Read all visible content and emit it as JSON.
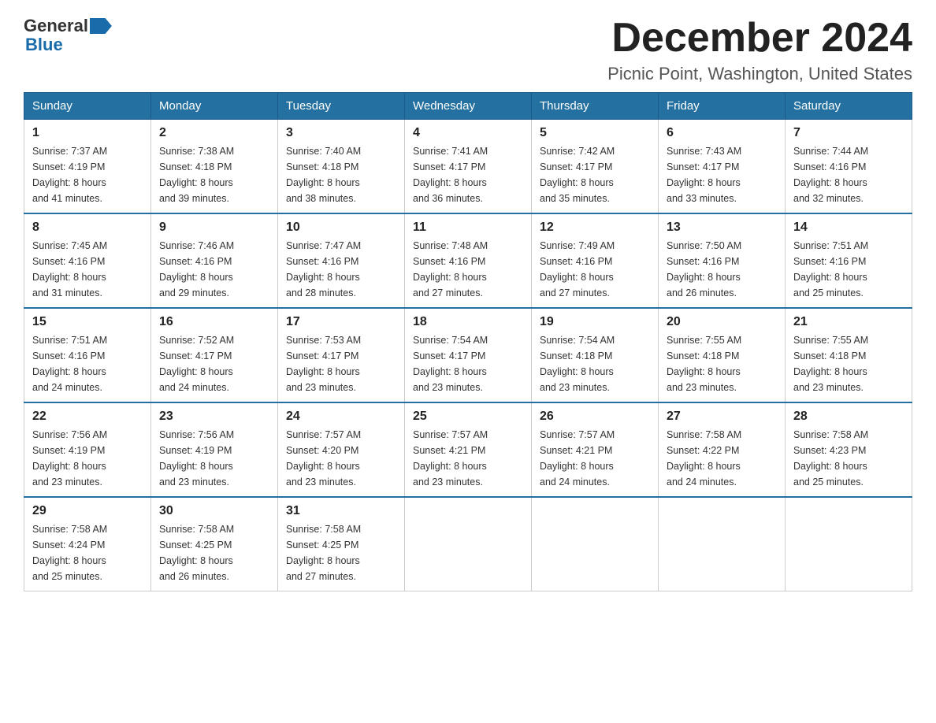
{
  "logo": {
    "general": "General",
    "blue": "Blue"
  },
  "header": {
    "title": "December 2024",
    "location": "Picnic Point, Washington, United States"
  },
  "days_of_week": [
    "Sunday",
    "Monday",
    "Tuesday",
    "Wednesday",
    "Thursday",
    "Friday",
    "Saturday"
  ],
  "weeks": [
    [
      {
        "day": "1",
        "sunrise": "7:37 AM",
        "sunset": "4:19 PM",
        "daylight": "8 hours and 41 minutes."
      },
      {
        "day": "2",
        "sunrise": "7:38 AM",
        "sunset": "4:18 PM",
        "daylight": "8 hours and 39 minutes."
      },
      {
        "day": "3",
        "sunrise": "7:40 AM",
        "sunset": "4:18 PM",
        "daylight": "8 hours and 38 minutes."
      },
      {
        "day": "4",
        "sunrise": "7:41 AM",
        "sunset": "4:17 PM",
        "daylight": "8 hours and 36 minutes."
      },
      {
        "day": "5",
        "sunrise": "7:42 AM",
        "sunset": "4:17 PM",
        "daylight": "8 hours and 35 minutes."
      },
      {
        "day": "6",
        "sunrise": "7:43 AM",
        "sunset": "4:17 PM",
        "daylight": "8 hours and 33 minutes."
      },
      {
        "day": "7",
        "sunrise": "7:44 AM",
        "sunset": "4:16 PM",
        "daylight": "8 hours and 32 minutes."
      }
    ],
    [
      {
        "day": "8",
        "sunrise": "7:45 AM",
        "sunset": "4:16 PM",
        "daylight": "8 hours and 31 minutes."
      },
      {
        "day": "9",
        "sunrise": "7:46 AM",
        "sunset": "4:16 PM",
        "daylight": "8 hours and 29 minutes."
      },
      {
        "day": "10",
        "sunrise": "7:47 AM",
        "sunset": "4:16 PM",
        "daylight": "8 hours and 28 minutes."
      },
      {
        "day": "11",
        "sunrise": "7:48 AM",
        "sunset": "4:16 PM",
        "daylight": "8 hours and 27 minutes."
      },
      {
        "day": "12",
        "sunrise": "7:49 AM",
        "sunset": "4:16 PM",
        "daylight": "8 hours and 27 minutes."
      },
      {
        "day": "13",
        "sunrise": "7:50 AM",
        "sunset": "4:16 PM",
        "daylight": "8 hours and 26 minutes."
      },
      {
        "day": "14",
        "sunrise": "7:51 AM",
        "sunset": "4:16 PM",
        "daylight": "8 hours and 25 minutes."
      }
    ],
    [
      {
        "day": "15",
        "sunrise": "7:51 AM",
        "sunset": "4:16 PM",
        "daylight": "8 hours and 24 minutes."
      },
      {
        "day": "16",
        "sunrise": "7:52 AM",
        "sunset": "4:17 PM",
        "daylight": "8 hours and 24 minutes."
      },
      {
        "day": "17",
        "sunrise": "7:53 AM",
        "sunset": "4:17 PM",
        "daylight": "8 hours and 23 minutes."
      },
      {
        "day": "18",
        "sunrise": "7:54 AM",
        "sunset": "4:17 PM",
        "daylight": "8 hours and 23 minutes."
      },
      {
        "day": "19",
        "sunrise": "7:54 AM",
        "sunset": "4:18 PM",
        "daylight": "8 hours and 23 minutes."
      },
      {
        "day": "20",
        "sunrise": "7:55 AM",
        "sunset": "4:18 PM",
        "daylight": "8 hours and 23 minutes."
      },
      {
        "day": "21",
        "sunrise": "7:55 AM",
        "sunset": "4:18 PM",
        "daylight": "8 hours and 23 minutes."
      }
    ],
    [
      {
        "day": "22",
        "sunrise": "7:56 AM",
        "sunset": "4:19 PM",
        "daylight": "8 hours and 23 minutes."
      },
      {
        "day": "23",
        "sunrise": "7:56 AM",
        "sunset": "4:19 PM",
        "daylight": "8 hours and 23 minutes."
      },
      {
        "day": "24",
        "sunrise": "7:57 AM",
        "sunset": "4:20 PM",
        "daylight": "8 hours and 23 minutes."
      },
      {
        "day": "25",
        "sunrise": "7:57 AM",
        "sunset": "4:21 PM",
        "daylight": "8 hours and 23 minutes."
      },
      {
        "day": "26",
        "sunrise": "7:57 AM",
        "sunset": "4:21 PM",
        "daylight": "8 hours and 24 minutes."
      },
      {
        "day": "27",
        "sunrise": "7:58 AM",
        "sunset": "4:22 PM",
        "daylight": "8 hours and 24 minutes."
      },
      {
        "day": "28",
        "sunrise": "7:58 AM",
        "sunset": "4:23 PM",
        "daylight": "8 hours and 25 minutes."
      }
    ],
    [
      {
        "day": "29",
        "sunrise": "7:58 AM",
        "sunset": "4:24 PM",
        "daylight": "8 hours and 25 minutes."
      },
      {
        "day": "30",
        "sunrise": "7:58 AM",
        "sunset": "4:25 PM",
        "daylight": "8 hours and 26 minutes."
      },
      {
        "day": "31",
        "sunrise": "7:58 AM",
        "sunset": "4:25 PM",
        "daylight": "8 hours and 27 minutes."
      },
      null,
      null,
      null,
      null
    ]
  ],
  "labels": {
    "sunrise": "Sunrise:",
    "sunset": "Sunset:",
    "daylight": "Daylight:"
  }
}
